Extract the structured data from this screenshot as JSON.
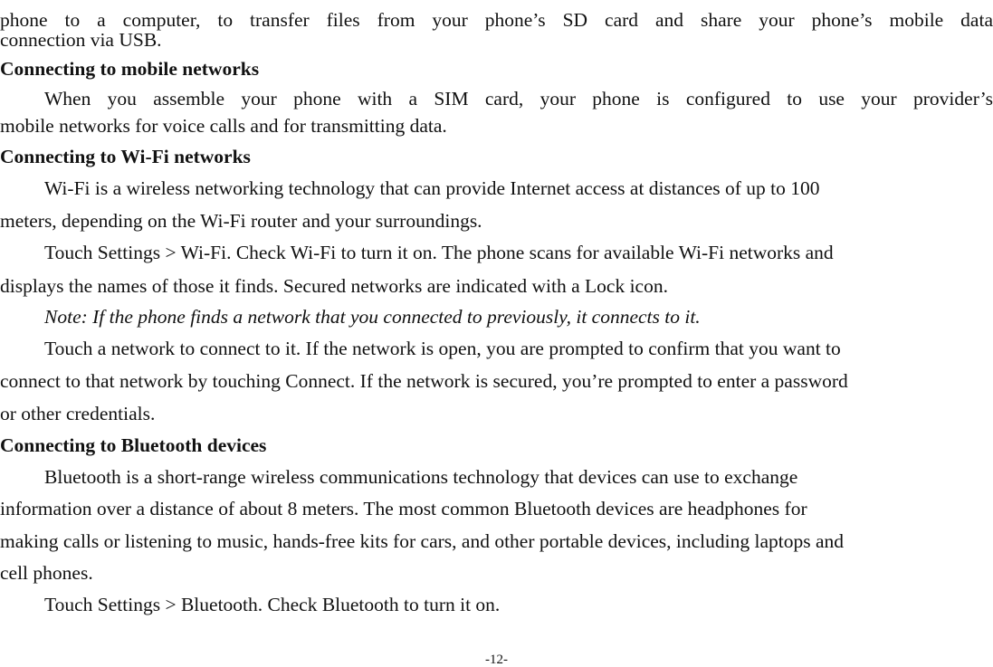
{
  "page": {
    "number": "-12-",
    "lines": [
      {
        "text": "phone to a computer, to transfer files from your phone’s SD card and share your phone’s mobile data",
        "style": "body"
      },
      {
        "text": "connection via USB.",
        "style": "body"
      },
      {
        "text": "Connecting to mobile networks",
        "style": "heading"
      },
      {
        "text": "When you assemble your phone with a SIM card, your phone is configured to use your provider’s",
        "style": "body"
      },
      {
        "text": "mobile networks for voice calls and for transmitting data.",
        "style": "body"
      },
      {
        "text": "Connecting to Wi-Fi networks",
        "style": "heading"
      },
      {
        "text": "Wi-Fi is a wireless networking technology that can provide Internet access at distances of up to 100",
        "style": "body"
      },
      {
        "text": "meters, depending on the Wi-Fi router and your surroundings.",
        "style": "body"
      },
      {
        "text": "Touch Settings > Wi-Fi. Check Wi-Fi to turn it on. The phone scans for available Wi-Fi networks and",
        "style": "body"
      },
      {
        "text": "displays the names of those it finds. Secured networks are indicated with a Lock icon.",
        "style": "body"
      },
      {
        "text": "Note: If the phone finds a network that you connected to previously, it connects to it.",
        "style": "note"
      },
      {
        "text": "Touch a network to connect to it. If the network is open, you are prompted to confirm that you want to",
        "style": "body"
      },
      {
        "text": "connect to that network by touching Connect. If the network is secured, you’re prompted to enter a password",
        "style": "body"
      },
      {
        "text": "or other credentials.",
        "style": "body"
      },
      {
        "text": "Connecting to Bluetooth devices",
        "style": "heading"
      },
      {
        "text": "Bluetooth is a short-range wireless communications technology that devices can use to exchange",
        "style": "body"
      },
      {
        "text": "information over a distance of about 8 meters. The most common Bluetooth devices are headphones for",
        "style": "body"
      },
      {
        "text": "making calls or listening to music, hands-free kits for cars, and other portable devices, including laptops and",
        "style": "body"
      },
      {
        "text": "cell phones.",
        "style": "body"
      },
      {
        "text": "Touch Settings > Bluetooth. Check Bluetooth to turn it on.",
        "style": "body"
      }
    ]
  }
}
